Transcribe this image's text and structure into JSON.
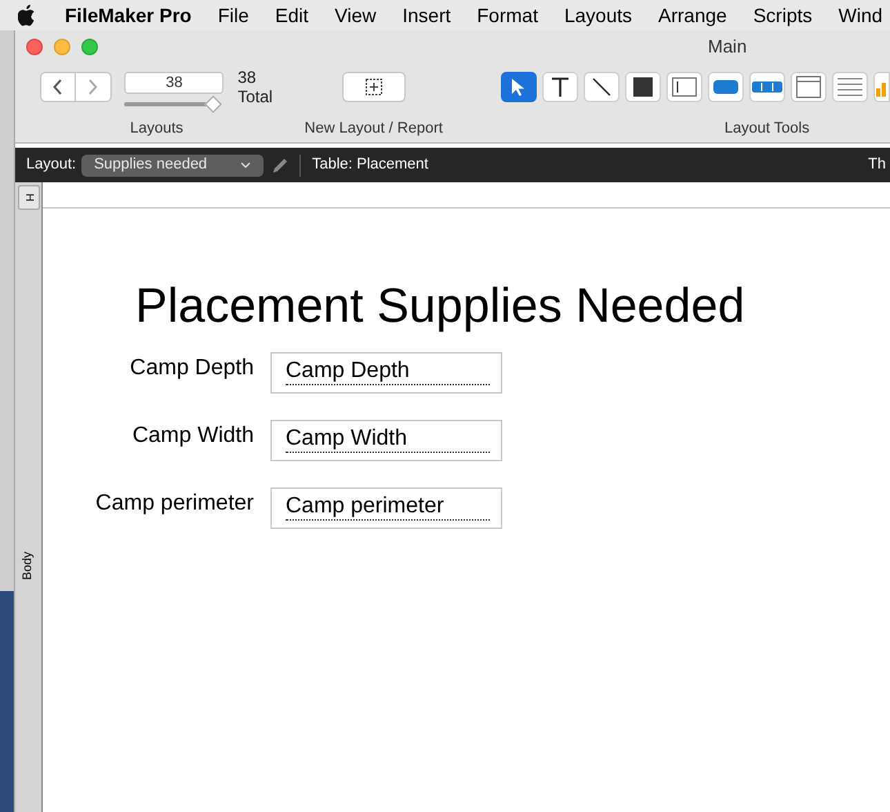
{
  "menu_bar": {
    "app": "FileMaker Pro",
    "items": [
      "File",
      "Edit",
      "View",
      "Insert",
      "Format",
      "Layouts",
      "Arrange",
      "Scripts",
      "Wind"
    ]
  },
  "window": {
    "title": "Main"
  },
  "toolbar": {
    "record_field": "38",
    "slider": {
      "level": 1
    },
    "count": "38",
    "count_label": "Total",
    "nav_label": "Layouts",
    "new_layout_label": "New Layout / Report",
    "tools_label": "Layout Tools",
    "tools": [
      {
        "kind": "pointer",
        "selected": true
      },
      {
        "kind": "text",
        "selected": false
      },
      {
        "kind": "line",
        "selected": false
      },
      {
        "kind": "shape",
        "selected": false
      },
      {
        "kind": "field",
        "selected": false
      },
      {
        "kind": "button",
        "selected": false
      },
      {
        "kind": "button_bar",
        "selected": false
      },
      {
        "kind": "portal",
        "selected": false
      },
      {
        "kind": "list",
        "selected": false
      },
      {
        "kind": "chart",
        "selected": false
      }
    ]
  },
  "layout_bar": {
    "label": "Layout:",
    "layout": "Supplies needed",
    "table": "Table: Placement",
    "cut_text": "Th"
  },
  "parts": {
    "header_tab": "H",
    "body_label": "Body"
  },
  "layout": {
    "title": "Placement Supplies Needed",
    "fields": [
      {
        "label": "Camp Depth",
        "value": "Camp Depth"
      },
      {
        "label": "Camp Width",
        "value": "Camp Width"
      },
      {
        "label": "Camp perimeter",
        "value": "Camp perimeter"
      }
    ]
  }
}
